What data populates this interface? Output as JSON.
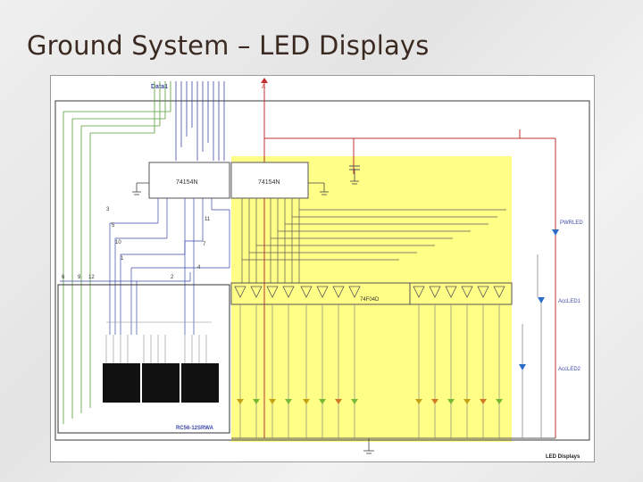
{
  "slide": {
    "title": "Ground System – LED Displays"
  },
  "schematic": {
    "bus_label": "Data1",
    "ic_left": "74154N",
    "ic_right": "74154N",
    "buffer_array": "74F04D",
    "display_part": "RC56-12SRWA",
    "frame_caption": "LED Displays",
    "led_labels": [
      "PWRLED",
      "AccLED1",
      "AccLED2"
    ],
    "pin_numbers": [
      "3",
      "5",
      "10",
      "1",
      "11",
      "7",
      "4",
      "2",
      "6",
      "9",
      "12"
    ],
    "supply_label": "A",
    "colors": {
      "highlight": "#fffe86",
      "wire_blue": "#3d4aa8",
      "wire_green": "#5a9a3a",
      "wire_red": "#c03030"
    }
  }
}
